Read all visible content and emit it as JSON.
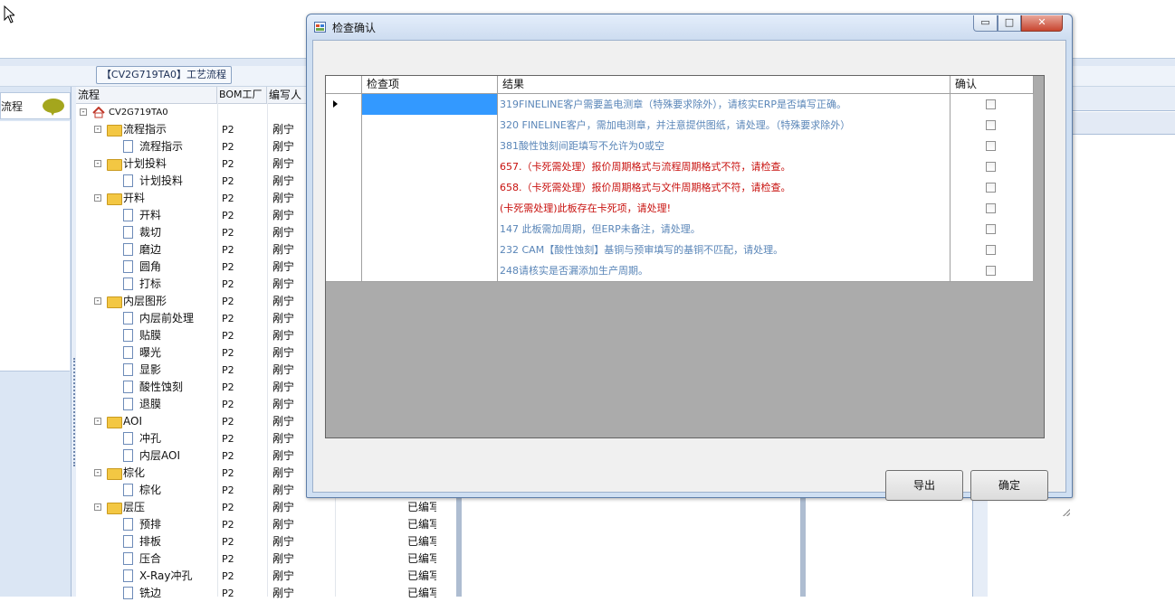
{
  "background_app": {
    "tab_title": "【CV2G719TA0】工艺流程",
    "left_panel_label": "流程",
    "tree_headers": [
      "流程",
      "BOM工厂",
      "编写人"
    ],
    "tree_rows": [
      {
        "name": "CV2G719TA0",
        "level": 0,
        "kind": "root",
        "factory": "",
        "author": "",
        "status": ""
      },
      {
        "name": "流程指示",
        "level": 1,
        "kind": "folder",
        "factory": "P2",
        "author": "剐宁",
        "status": ""
      },
      {
        "name": "流程指示",
        "level": 2,
        "kind": "doc",
        "factory": "P2",
        "author": "剐宁",
        "status": ""
      },
      {
        "name": "计划投料",
        "level": 1,
        "kind": "folder",
        "factory": "P2",
        "author": "剐宁",
        "status": ""
      },
      {
        "name": "计划投料",
        "level": 2,
        "kind": "doc",
        "factory": "P2",
        "author": "剐宁",
        "status": ""
      },
      {
        "name": "开料",
        "level": 1,
        "kind": "folder",
        "factory": "P2",
        "author": "剐宁",
        "status": ""
      },
      {
        "name": "开料",
        "level": 2,
        "kind": "doc",
        "factory": "P2",
        "author": "剐宁",
        "status": ""
      },
      {
        "name": "裁切",
        "level": 2,
        "kind": "doc",
        "factory": "P2",
        "author": "剐宁",
        "status": ""
      },
      {
        "name": "磨边",
        "level": 2,
        "kind": "doc",
        "factory": "P2",
        "author": "剐宁",
        "status": ""
      },
      {
        "name": "圆角",
        "level": 2,
        "kind": "doc",
        "factory": "P2",
        "author": "剐宁",
        "status": ""
      },
      {
        "name": "打标",
        "level": 2,
        "kind": "doc",
        "factory": "P2",
        "author": "剐宁",
        "status": ""
      },
      {
        "name": "内层图形",
        "level": 1,
        "kind": "folder",
        "factory": "P2",
        "author": "剐宁",
        "status": ""
      },
      {
        "name": "内层前处理",
        "level": 2,
        "kind": "doc",
        "factory": "P2",
        "author": "剐宁",
        "status": ""
      },
      {
        "name": "贴膜",
        "level": 2,
        "kind": "doc",
        "factory": "P2",
        "author": "剐宁",
        "status": ""
      },
      {
        "name": "曝光",
        "level": 2,
        "kind": "doc",
        "factory": "P2",
        "author": "剐宁",
        "status": ""
      },
      {
        "name": "显影",
        "level": 2,
        "kind": "doc",
        "factory": "P2",
        "author": "剐宁",
        "status": ""
      },
      {
        "name": "酸性蚀刻",
        "level": 2,
        "kind": "doc",
        "factory": "P2",
        "author": "剐宁",
        "status": ""
      },
      {
        "name": "退膜",
        "level": 2,
        "kind": "doc",
        "factory": "P2",
        "author": "剐宁",
        "status": ""
      },
      {
        "name": "AOI",
        "level": 1,
        "kind": "folder",
        "factory": "P2",
        "author": "剐宁",
        "status": ""
      },
      {
        "name": "冲孔",
        "level": 2,
        "kind": "doc",
        "factory": "P2",
        "author": "剐宁",
        "status": ""
      },
      {
        "name": "内层AOI",
        "level": 2,
        "kind": "doc",
        "factory": "P2",
        "author": "剐宁",
        "status": ""
      },
      {
        "name": "棕化",
        "level": 1,
        "kind": "folder",
        "factory": "P2",
        "author": "剐宁",
        "status": ""
      },
      {
        "name": "棕化",
        "level": 2,
        "kind": "doc",
        "factory": "P2",
        "author": "剐宁",
        "status": ""
      },
      {
        "name": "层压",
        "level": 1,
        "kind": "folder",
        "factory": "P2",
        "author": "剐宁",
        "status": "已编写"
      },
      {
        "name": "预排",
        "level": 2,
        "kind": "doc",
        "factory": "P2",
        "author": "剐宁",
        "status": "已编写"
      },
      {
        "name": "排板",
        "level": 2,
        "kind": "doc",
        "factory": "P2",
        "author": "剐宁",
        "status": "已编写"
      },
      {
        "name": "压合",
        "level": 2,
        "kind": "doc",
        "factory": "P2",
        "author": "剐宁",
        "status": "已编写"
      },
      {
        "name": "X-Ray冲孔",
        "level": 2,
        "kind": "doc",
        "factory": "P2",
        "author": "剐宁",
        "status": "已编写"
      },
      {
        "name": "铣边",
        "level": 2,
        "kind": "doc",
        "factory": "P2",
        "author": "剐宁",
        "status": "已编写"
      }
    ]
  },
  "dialog": {
    "title": "检查确认",
    "window_buttons": {
      "minimize": "▭",
      "maximize": "□",
      "close": "✕"
    },
    "columns": [
      "检查项",
      "结果",
      "确认"
    ],
    "rows": [
      {
        "item": "",
        "result": "319FINELINE客户需要盖电测章（特殊要求除外），请核实ERP是否填写正确。",
        "severity": "normal",
        "confirmed": false,
        "selected": true
      },
      {
        "item": "",
        "result": "320 FINELINE客户，需加电测章，并注意提供图纸，请处理。（特殊要求除外）",
        "severity": "normal",
        "confirmed": false,
        "selected": false
      },
      {
        "item": "",
        "result": "381酸性蚀刻间距填写不允许为0或空",
        "severity": "normal",
        "confirmed": false,
        "selected": false
      },
      {
        "item": "",
        "result": "657.（卡死需处理）报价周期格式与流程周期格式不符，请检查。",
        "severity": "alert",
        "confirmed": false,
        "selected": false
      },
      {
        "item": "",
        "result": "658.（卡死需处理）报价周期格式与文件周期格式不符，请检查。",
        "severity": "alert",
        "confirmed": false,
        "selected": false
      },
      {
        "item": "",
        "result": "(卡死需处理)此板存在卡死项，请处理!",
        "severity": "alert",
        "confirmed": false,
        "selected": false
      },
      {
        "item": "",
        "result": "147 此板需加周期，但ERP未备注，请处理。",
        "severity": "normal",
        "confirmed": false,
        "selected": false
      },
      {
        "item": "",
        "result": "232 CAM【酸性蚀刻】基铜与预审填写的基铜不匹配，请处理。",
        "severity": "normal",
        "confirmed": false,
        "selected": false
      },
      {
        "item": "",
        "result": "248请核实是否漏添加生产周期。",
        "severity": "normal",
        "confirmed": false,
        "selected": false
      }
    ],
    "buttons": {
      "export": "导出",
      "ok": "确定"
    },
    "colors": {
      "normal_text": "#5a86b8",
      "alert_text": "#c8110e",
      "selection": "#3399ff"
    }
  }
}
